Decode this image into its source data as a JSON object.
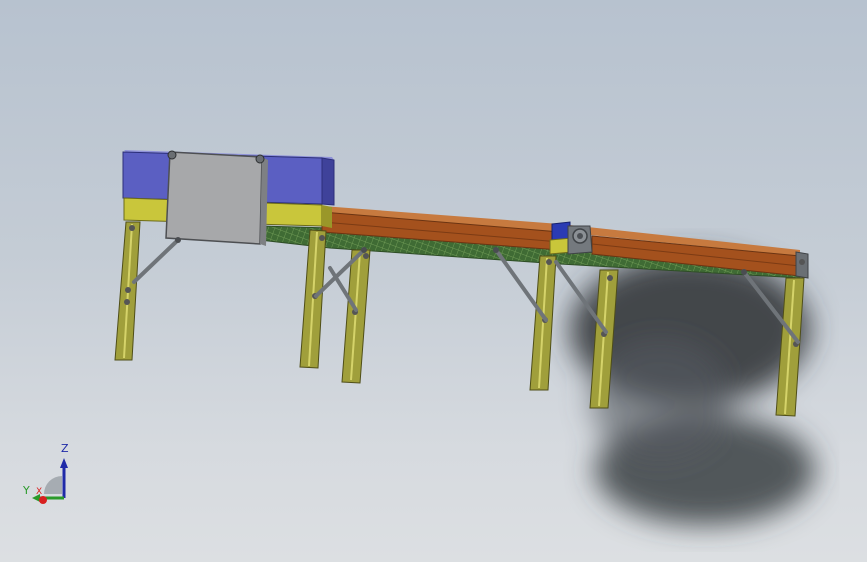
{
  "scene": {
    "description_visible": false,
    "colors": {
      "blue_panel": "#5a5fc0",
      "yellow_frame": "#c8c53a",
      "leg_olive": "#9d9c3a",
      "belt_brown": "#a3511c",
      "mesh_green": "#4e7a3b",
      "gray_cover": "#a9aaac",
      "brace_gray": "#6e7479",
      "motor_blue": "#2b3bb3"
    }
  },
  "triad": {
    "z_label": "Z",
    "y_label": "Y",
    "x_label": "X",
    "icons": [
      "axis-triad-icon"
    ]
  }
}
